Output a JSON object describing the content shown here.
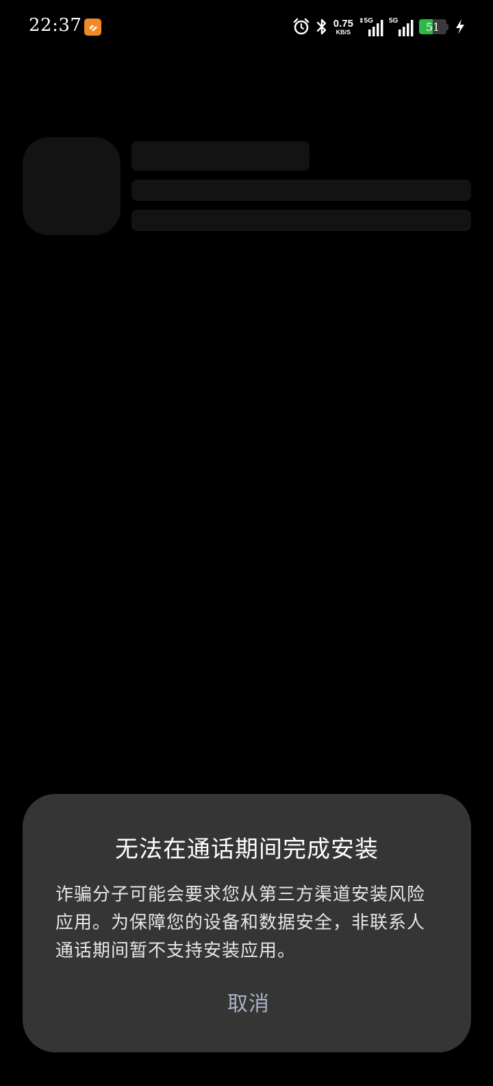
{
  "status_bar": {
    "time": "22:37",
    "notification_icon": "app-notification-icon",
    "icons": [
      "alarm-clock-icon",
      "bluetooth-icon",
      "data-arrows-icon",
      "signal-icon",
      "signal-icon",
      "battery-icon",
      "charging-bolt-icon"
    ],
    "net_speed_value": "0.75",
    "net_speed_unit": "KB/S",
    "sim1_label": "5G",
    "sim2_label": "5G",
    "battery_level": "51",
    "battery_fraction": 0.51,
    "battery_color": "#2fb84a",
    "notification_icon_color": "#f08a24"
  },
  "dialog": {
    "title": "无法在通话期间完成安装",
    "message": "诈骗分子可能会要求您从第三方渠道安装风险应用。为保障您的设备和数据安全，非联系人通话期间暂不支持安装应用。",
    "cancel_label": "取消",
    "background_color": "#353535",
    "cancel_color": "#a9b2c4"
  }
}
